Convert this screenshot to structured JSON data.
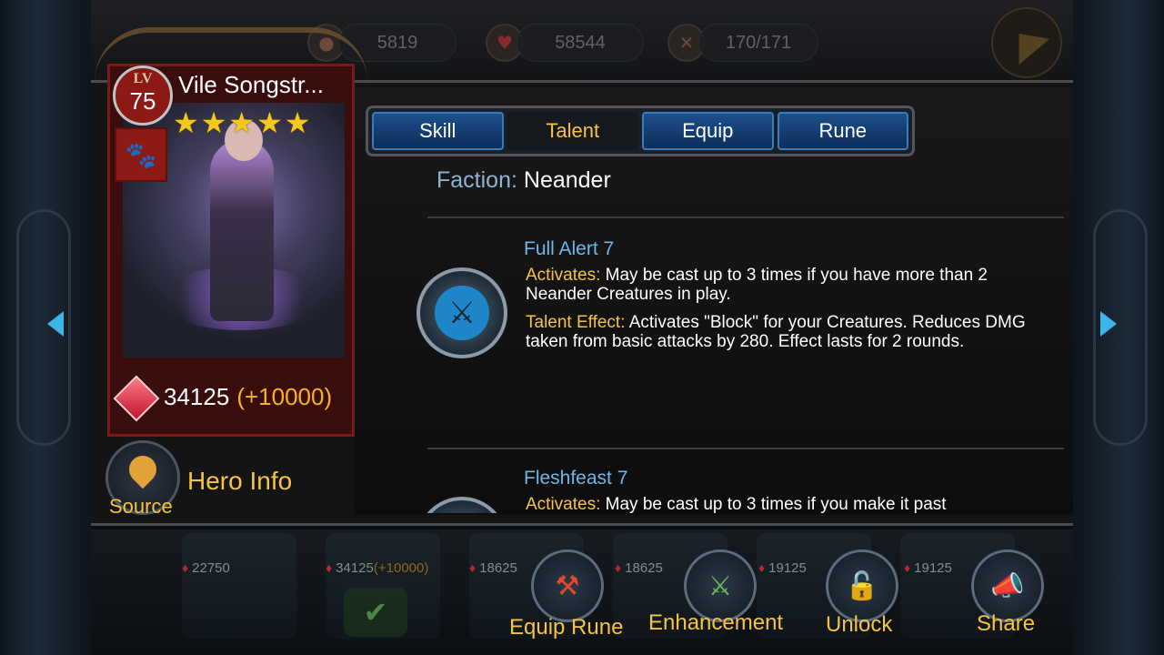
{
  "top_stats": {
    "gold": "5819",
    "hp": "58544",
    "capacity": "170/171"
  },
  "hero": {
    "name": "Vile Songstr...",
    "level_label": "LV",
    "level": "75",
    "stars": 5,
    "power": "34125",
    "power_bonus": "(+10000)"
  },
  "left_actions": {
    "source_label": "Source",
    "hero_info_label": "Hero Info"
  },
  "tabs": [
    {
      "label": "Skill",
      "active": false
    },
    {
      "label": "Talent",
      "active": true
    },
    {
      "label": "Equip",
      "active": false
    },
    {
      "label": "Rune",
      "active": false
    }
  ],
  "faction": {
    "key": "Faction:",
    "value": "Neander"
  },
  "talents": [
    {
      "title": "Full Alert 7",
      "activates_key": "Activates:",
      "activates_text": "May be cast up to 3 times if you have more than 2 Neander Creatures in play.",
      "effect_key": "Talent Effect:",
      "effect_text": "Activates \"Block\" for your Creatures. Reduces DMG taken from basic attacks by 280. Effect lasts for 2 rounds."
    },
    {
      "title": "Fleshfeast 7",
      "activates_key": "Activates:",
      "activates_text": "May be cast up to 3 times if you make it past"
    }
  ],
  "bottom_slots": [
    {
      "power": "22750"
    },
    {
      "power": "34125",
      "bonus": "(+10000)"
    },
    {
      "power": "18625"
    },
    {
      "power": "18625"
    },
    {
      "power": "19125"
    },
    {
      "power": "19125"
    }
  ],
  "bottom_actions": {
    "equip_rune": "Equip Rune",
    "enhancement": "Enhancement",
    "unlock": "Unlock",
    "share": "Share"
  },
  "colors": {
    "accent_gold": "#f6c342",
    "title_blue": "#6fb6ea",
    "tab_blue": "#1d4f8d"
  }
}
